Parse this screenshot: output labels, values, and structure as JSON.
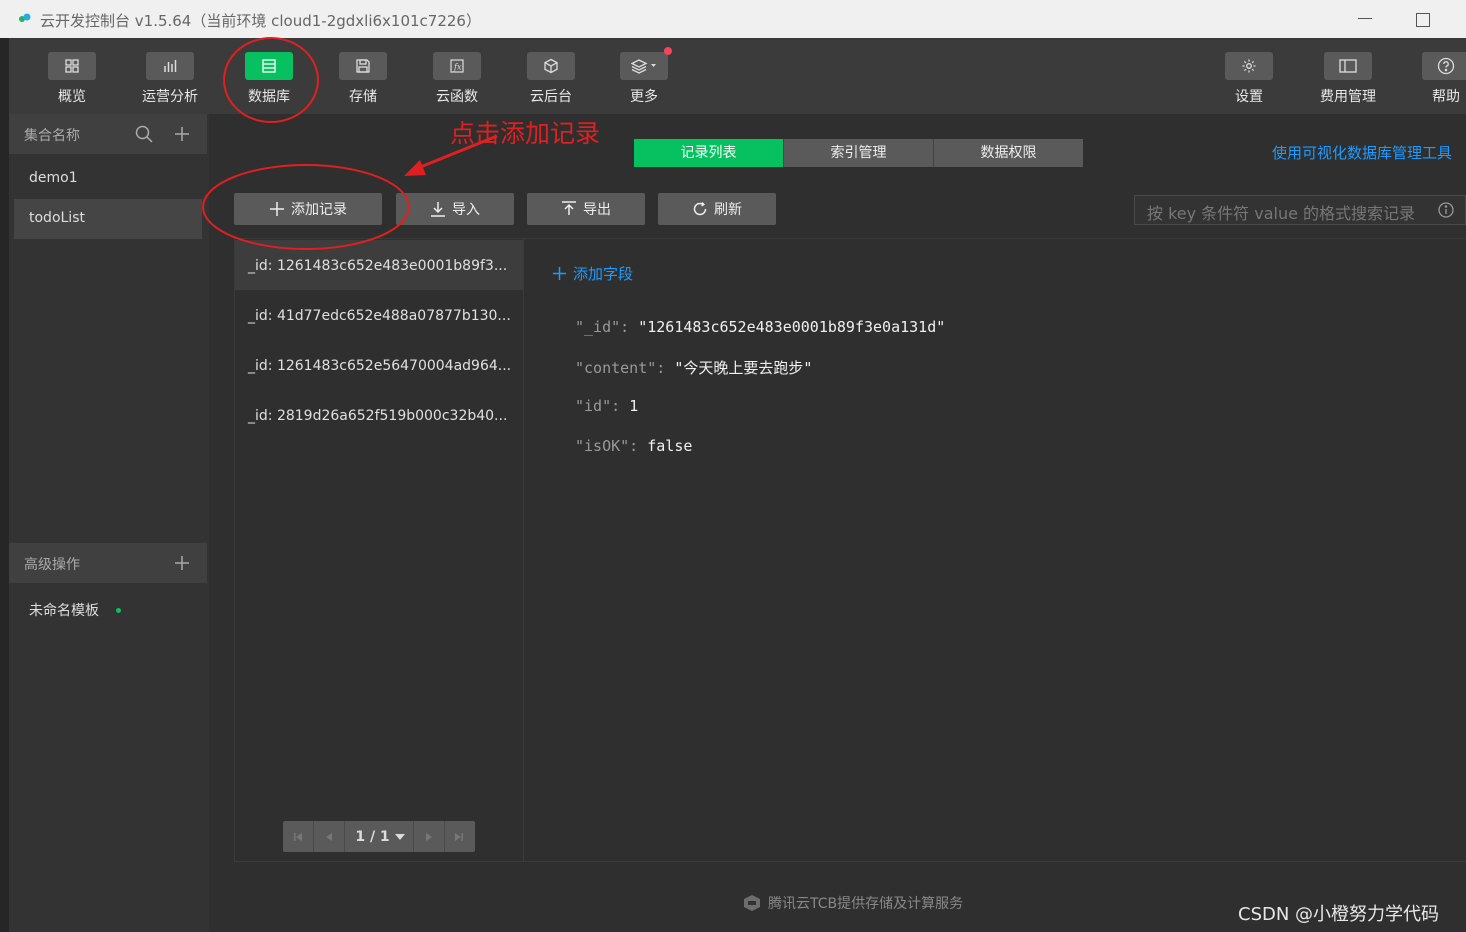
{
  "window": {
    "title": "云开发控制台 v1.5.64（当前环境 cloud1-2gdxli6x101c7226）"
  },
  "toolbar": {
    "items": [
      {
        "label": "概览",
        "icon": "grid-icon"
      },
      {
        "label": "运营分析",
        "icon": "bar-chart-icon"
      },
      {
        "label": "数据库",
        "icon": "database-icon",
        "active": true
      },
      {
        "label": "存储",
        "icon": "floppy-icon"
      },
      {
        "label": "云函数",
        "icon": "function-icon"
      },
      {
        "label": "云后台",
        "icon": "cube-icon"
      },
      {
        "label": "更多",
        "icon": "layers-icon"
      },
      {
        "label": "设置",
        "icon": "gear-icon"
      },
      {
        "label": "费用管理",
        "icon": "billing-icon"
      },
      {
        "label": "帮助",
        "icon": "help-icon"
      }
    ]
  },
  "sidebar": {
    "collections_header": "集合名称",
    "collections": [
      "demo1",
      "todoList"
    ],
    "selected_collection": "todoList",
    "advanced_header": "高级操作",
    "advanced_items": [
      "未命名模板"
    ]
  },
  "tabs": [
    "记录列表",
    "索引管理",
    "数据权限"
  ],
  "visual_tool_link": "使用可视化数据库管理工具",
  "actions": {
    "add": "添加记录",
    "import": "导入",
    "export": "导出",
    "refresh": "刷新"
  },
  "search": {
    "placeholder": "按 key 条件符 value 的格式搜索记录"
  },
  "records": [
    "_id: 1261483c652e483e0001b89f3...",
    "_id: 41d77edc652e488a07877b130...",
    "_id: 1261483c652e56470004ad964...",
    "_id: 2819d26a652f519b000c32b40..."
  ],
  "pager": {
    "label": "1 / 1"
  },
  "detail": {
    "add_field": "添加字段",
    "fields": [
      {
        "key": "\"_id\":",
        "value": "\"1261483c652e483e0001b89f3e0a131d\""
      },
      {
        "key": "\"content\":",
        "value": "\"今天晚上要去跑步\""
      },
      {
        "key": "\"id\":",
        "value": "1"
      },
      {
        "key": "\"isOK\":",
        "value": "false"
      }
    ]
  },
  "footer": "腾讯云TCB提供存储及计算服务",
  "watermark": "CSDN @小橙努力学代码",
  "annotation": {
    "text": "点击添加记录",
    "color": "#e02020"
  },
  "colors": {
    "accent": "#07c160",
    "link": "#1e9bff",
    "notification": "#f5455a"
  }
}
